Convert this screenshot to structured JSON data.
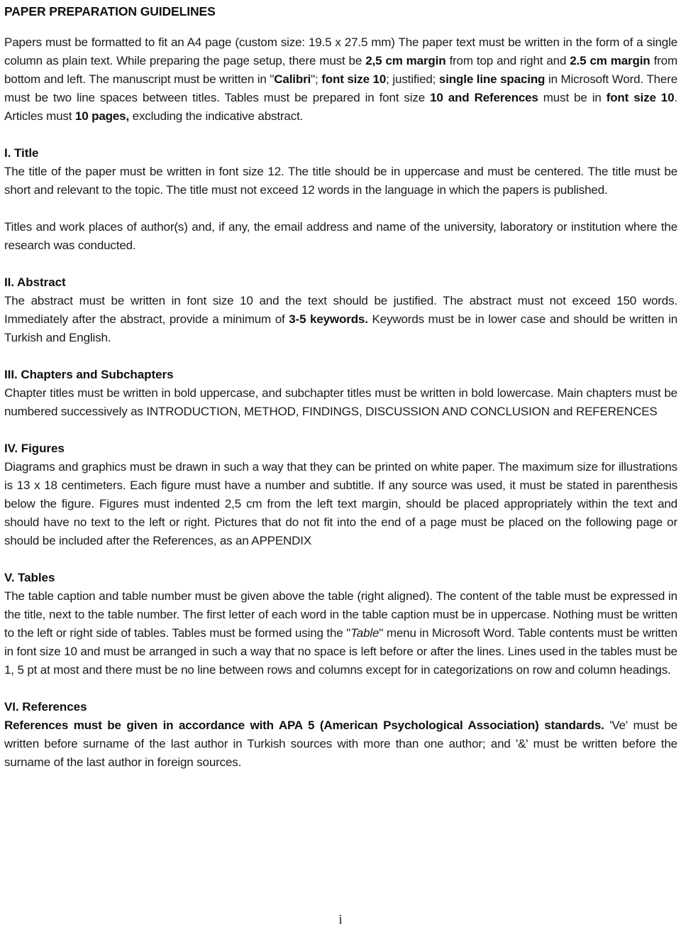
{
  "document": {
    "title": "PAPER PREPARATION GUIDELINES",
    "page_number": "i"
  },
  "intro": {
    "part1": "Papers must be formatted to fit an A4 page (custom size: 19.5 x 27.5 mm) The paper text must be written in the form of a single column as plain text. While preparing the page setup, there must be ",
    "bold1": "2,5 cm margin",
    "part2": " from top and right and ",
    "bold2": "2.5 cm margin",
    "part3": " from bottom and left. The manuscript must be written in \"",
    "bold3": "Calibri",
    "part4": "\"; ",
    "bold4": "font size 10",
    "part5": "; justified; ",
    "bold5": "single line spacing",
    "part6": " in Microsoft Word. There must be two line spaces between titles. Tables must be prepared in font size ",
    "bold6": "10 and References",
    "part7": " must be in ",
    "bold7": "font size 10",
    "part8": ". Articles must ",
    "bold8": "10 pages,",
    "part9": " excluding the indicative abstract."
  },
  "sections": [
    {
      "heading": "I. Title",
      "paragraphs": [
        "The title of the paper must be written in font size 12. The title should be in uppercase and must be centered. The title must be short and relevant to the topic. The title must not exceed 12 words in the language in which the papers is published.",
        "Titles and work places of author(s) and, if any, the email address and name of the university, laboratory or institution where the research was conducted."
      ]
    },
    {
      "heading": "II. Abstract",
      "abstract": {
        "part1": "The abstract must be written in font size 10 and the text should be justified. The abstract must not exceed 150 words.  Immediately after the abstract, provide a minimum of ",
        "bold1": "3-5  keywords.",
        "part2": "  Keywords must be in lower case and should be written in Turkish and English."
      }
    },
    {
      "heading": "III. Chapters and Subchapters",
      "paragraphs": [
        "Chapter titles must be written in bold uppercase, and subchapter titles must be written in bold lowercase. Main chapters must be numbered successively as INTRODUCTION, METHOD, FINDINGS, DISCUSSION AND CONCLUSION and REFERENCES"
      ]
    },
    {
      "heading": "IV. Figures",
      "paragraphs": [
        "Diagrams and graphics must be drawn in such a way that they can be printed on white paper. The maximum size for illustrations is 13 x 18 centimeters. Each figure must have a number and subtitle. If any source was used, it must be stated in parenthesis below the figure. Figures must indented 2,5 cm from the left text margin, should be placed appropriately within the text and should have no text to the left or right. Pictures that do not fit into the end of a page must be placed on the following page or should be included after the References, as an APPENDIX"
      ]
    },
    {
      "heading": "V. Tables",
      "tables": {
        "part1": "The table caption and table number must be given above the table (right aligned). The content of the table must be expressed in the title, next to the table number. The first letter of each word in the table caption must be in uppercase. Nothing must be written to the left or right side of tables.  Tables must be formed using the \"",
        "italic1": "Table",
        "part2": "\" menu in Microsoft Word. Table contents must be written in font size 10 and must be arranged in such a way that no space is left before or after the lines.   Lines used in the tables must be 1, 5 pt at most and there must be no line between rows and columns except for in categorizations on row and column headings."
      }
    },
    {
      "heading": "VI. References",
      "references": {
        "bold1": "References must be given in accordance with APA 5 (American Psychological Association) standards.",
        "part1": " 'Ve' must be written before surname of the last author in Turkish sources with more than one author; and '&' must be written before the surname of the last author in foreign sources."
      }
    }
  ]
}
